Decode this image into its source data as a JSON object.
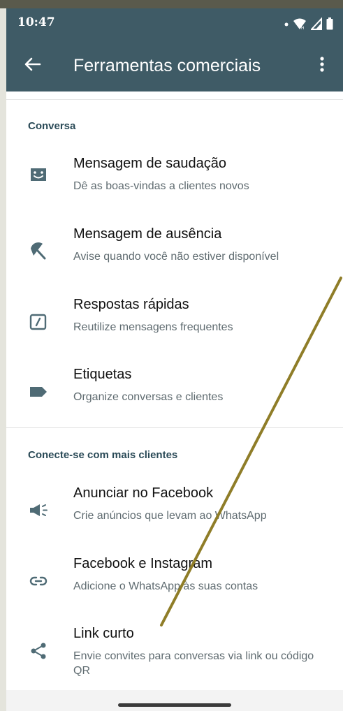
{
  "status": {
    "time": "10:47"
  },
  "appbar": {
    "title": "Ferramentas comerciais"
  },
  "sections": [
    {
      "header": "Conversa",
      "items": [
        {
          "label": "Mensagem de saudação",
          "sub": "Dê as boas-vindas a clientes novos",
          "icon": "greeting-message-icon"
        },
        {
          "label": "Mensagem de ausência",
          "sub": "Avise quando você não estiver disponível",
          "icon": "away-message-icon"
        },
        {
          "label": "Respostas rápidas",
          "sub": "Reutilize mensagens frequentes",
          "icon": "quick-replies-icon"
        },
        {
          "label": "Etiquetas",
          "sub": "Organize conversas e clientes",
          "icon": "label-icon"
        }
      ]
    },
    {
      "header": "Conecte-se com mais clientes",
      "items": [
        {
          "label": "Anunciar no Facebook",
          "sub": "Crie anúncios que levam ao WhatsApp",
          "icon": "megaphone-icon"
        },
        {
          "label": "Facebook e Instagram",
          "sub": "Adicione o WhatsApp às suas contas",
          "icon": "link-icon"
        },
        {
          "label": "Link curto",
          "sub": "Envie convites para conversas via link ou código QR",
          "icon": "share-icon"
        }
      ]
    }
  ],
  "colors": {
    "appbar": "#3f5b66",
    "icon": "#4f6b75",
    "section_header": "#2a4a57",
    "annotation_line": "#8f7d28"
  }
}
